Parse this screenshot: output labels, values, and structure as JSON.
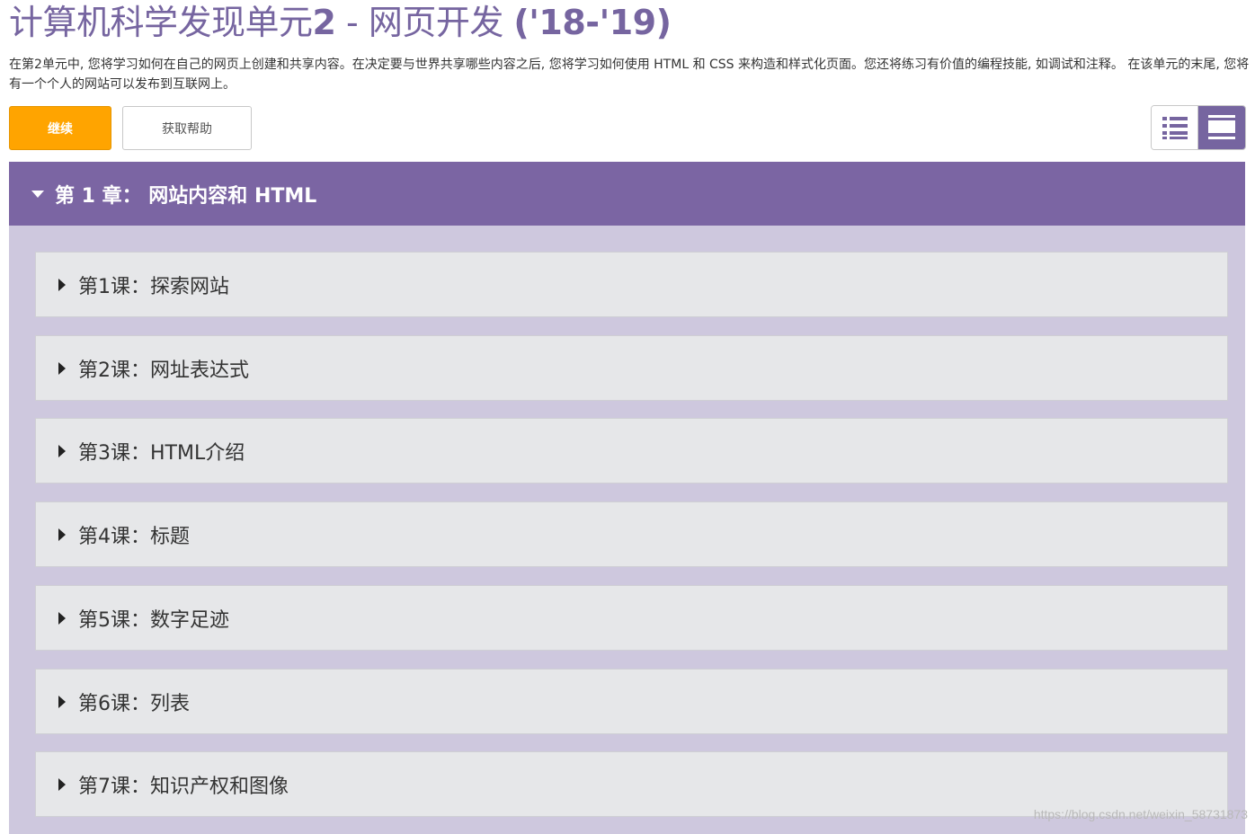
{
  "header": {
    "title_plain": "计算机科学发现单元",
    "title_bold1": "2",
    "title_mid": " - 网页开发 ",
    "title_bold2": "('18-'19)"
  },
  "description": "在第2单元中, 您将学习如何在自己的网页上创建和共享内容。在决定要与世界共享哪些内容之后, 您将学习如何使用 HTML 和 CSS 来构造和样式化页面。您还将练习有价值的编程技能, 如调试和注释。 在该单元的末尾, 您将有一个个人的网站可以发布到互联网上。",
  "actions": {
    "continue_label": "继续",
    "help_label": "获取帮助"
  },
  "view_toggle": {
    "list_icon": "list-view-icon",
    "detail_icon": "detail-view-icon"
  },
  "chapter": {
    "title": "第 1 章： 网站内容和 HTML"
  },
  "lessons": [
    {
      "title": "第1课：探索网站"
    },
    {
      "title": "第2课：网址表达式"
    },
    {
      "title": "第3课：HTML介绍"
    },
    {
      "title": "第4课：标题"
    },
    {
      "title": "第5课：数字足迹"
    },
    {
      "title": "第6课：列表"
    },
    {
      "title": "第7课：知识产权和图像"
    }
  ],
  "watermark": "https://blog.csdn.net/weixin_58731873",
  "colors": {
    "accent": "#7665a0",
    "continue": "#ffa400",
    "chapter_header": "#7b65a3",
    "chapter_body": "#cec8de",
    "lesson_bg": "#e6e7e9"
  }
}
